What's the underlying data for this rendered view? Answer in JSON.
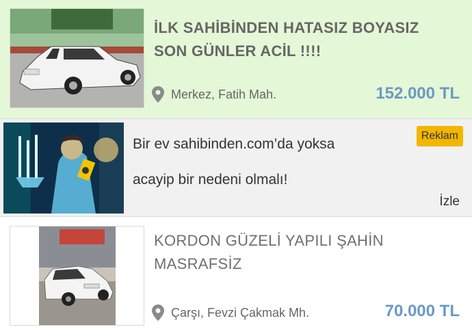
{
  "listings": [
    {
      "title_line1": "İLK SAHİBİNDEN HATASIZ BOYASIZ",
      "title_line2": "SON GÜNLER ACİL !!!!",
      "location": "Merkez, Fatih Mah.",
      "price": "152.000 TL",
      "location_icon": "map-pin-icon"
    },
    {
      "title_line1": "KORDON GÜZELİ YAPILI ŞAHİN",
      "title_line2": "MASRAFSİZ",
      "location": "Çarşı, Fevzi Çakmak Mh.",
      "price": "70.000 TL",
      "location_icon": "map-pin-icon"
    }
  ],
  "ad": {
    "line1": "Bir ev sahibinden.com’da yoksa",
    "line2": "acayip bir nedeni olmalı!",
    "badge": "Reklam",
    "watch": "İzle",
    "badge_color": "#f2b600"
  },
  "colors": {
    "featured_bg": "#e4f7d6",
    "price": "#6b99c7",
    "ad_bg": "#f1f1f1"
  }
}
